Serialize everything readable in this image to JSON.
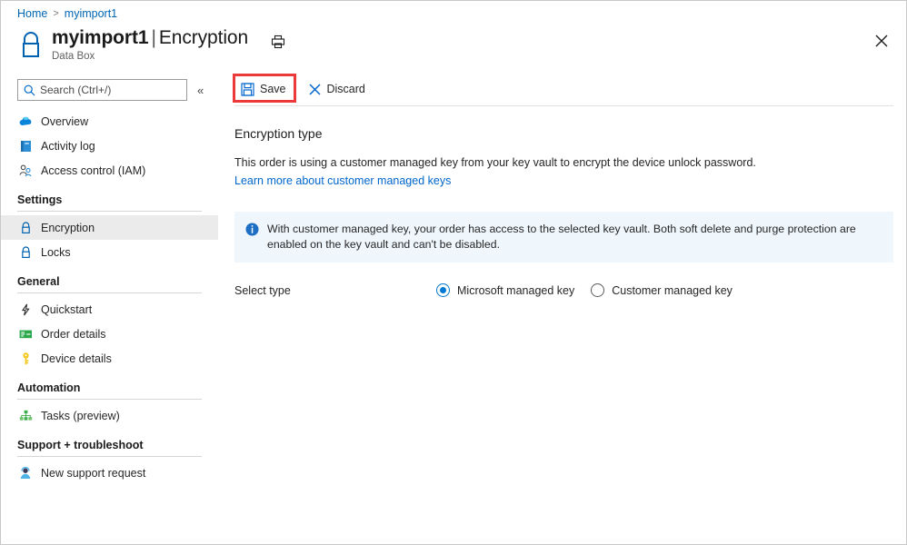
{
  "breadcrumb": {
    "items": [
      "Home",
      "myimport1"
    ],
    "separator": ">"
  },
  "header": {
    "resource_icon": "lock-icon",
    "resource_name": "myimport1",
    "pipe": "|",
    "page_name": "Encryption",
    "subtitle": "Data Box",
    "print_icon": "print-icon",
    "close_icon": "close-icon"
  },
  "sidebar": {
    "search": {
      "placeholder": "Search (Ctrl+/)",
      "value": "",
      "icon": "search-icon"
    },
    "collapse_icon": "chevron-double-left-icon",
    "top_items": [
      {
        "label": "Overview",
        "icon": "cloud-icon",
        "active": false
      },
      {
        "label": "Activity log",
        "icon": "activity-log-icon",
        "active": false
      },
      {
        "label": "Access control (IAM)",
        "icon": "people-icon",
        "active": false
      }
    ],
    "groups": [
      {
        "title": "Settings",
        "items": [
          {
            "label": "Encryption",
            "icon": "lock-icon",
            "active": true
          },
          {
            "label": "Locks",
            "icon": "lock-icon",
            "active": false
          }
        ]
      },
      {
        "title": "General",
        "items": [
          {
            "label": "Quickstart",
            "icon": "lightning-icon",
            "active": false
          },
          {
            "label": "Order details",
            "icon": "order-details-icon",
            "active": false
          },
          {
            "label": "Device details",
            "icon": "key-icon",
            "active": false
          }
        ]
      },
      {
        "title": "Automation",
        "items": [
          {
            "label": "Tasks (preview)",
            "icon": "tasks-hierarchy-icon",
            "active": false
          }
        ]
      },
      {
        "title": "Support + troubleshoot",
        "items": [
          {
            "label": "New support request",
            "icon": "support-person-icon",
            "active": false
          }
        ]
      }
    ]
  },
  "toolbar": {
    "save_label": "Save",
    "save_icon": "save-disk-icon",
    "discard_label": "Discard",
    "discard_icon": "x-icon",
    "save_highlighted": true,
    "highlight_color": "#ec3a3a"
  },
  "main": {
    "section_title": "Encryption type",
    "description": "This order is using a customer managed key from your key vault to encrypt the device unlock password.",
    "learn_more_link": "Learn more about customer managed keys",
    "info_banner": {
      "icon": "info-circle-icon",
      "text": "With customer managed key, your order has access to the selected key vault. Both soft delete and purge protection are enabled on the key vault and can't be disabled.",
      "background": "#eff6fc"
    },
    "select_type": {
      "label": "Select type",
      "options": [
        {
          "label": "Microsoft managed key",
          "selected": true
        },
        {
          "label": "Customer managed key",
          "selected": false
        }
      ]
    }
  },
  "colors": {
    "accent": "#0078d4",
    "link": "#0066cc",
    "text": "#262626",
    "active_nav_bg": "#ebebeb",
    "info_bg": "#eff6fc",
    "highlight": "#ec3a3a"
  }
}
